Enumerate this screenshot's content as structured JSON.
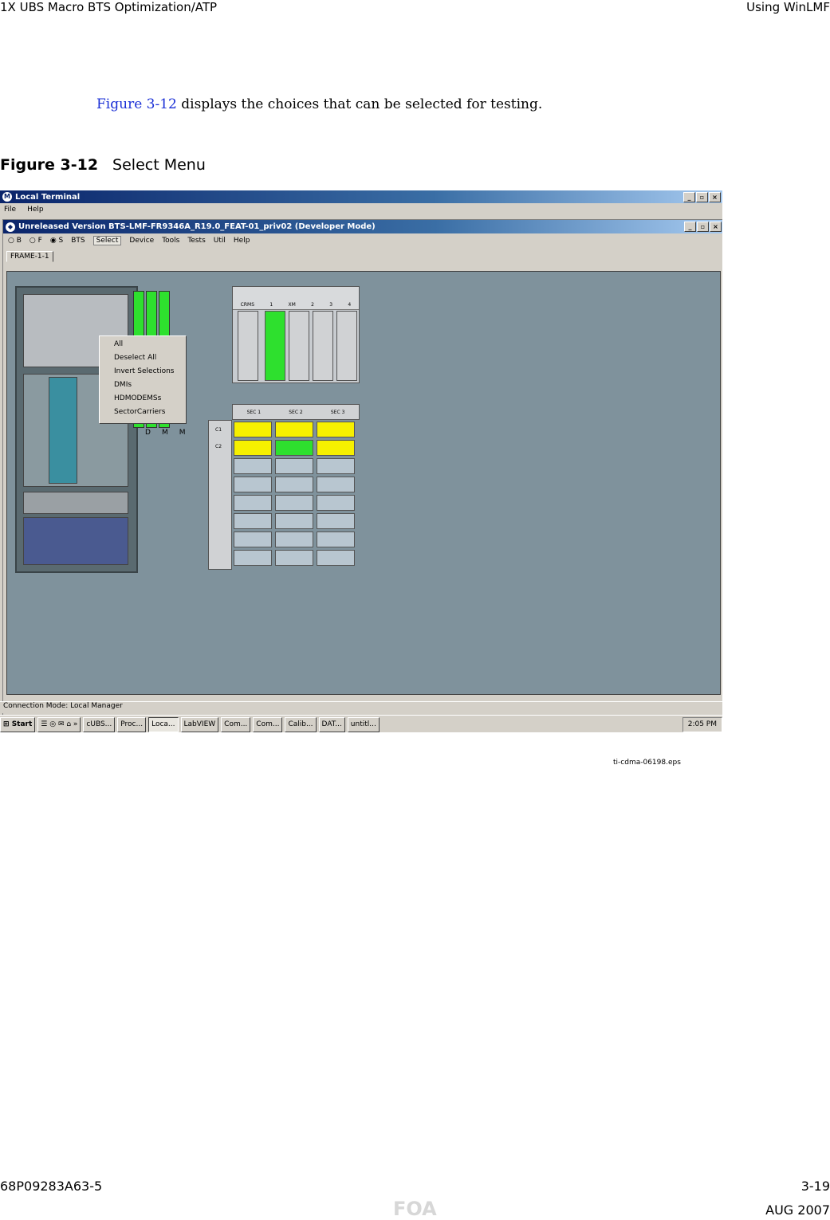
{
  "header": {
    "left": "1X UBS Macro BTS Optimization/ATP",
    "right": "Using WinLMF"
  },
  "intro": {
    "link": "Figure 3-12",
    "rest": " displays the choices that can be selected for testing."
  },
  "figure": {
    "number": "Figure 3-12",
    "title": "Select Menu"
  },
  "screenshot": {
    "outer_title": "Local Terminal",
    "outer_menu": [
      "File",
      "Help"
    ],
    "inner_title": "Unreleased Version BTS-LMF-FR9346A_R19.0_FEAT-01_priv02 (Developer Mode)",
    "radio_b": "B",
    "radio_f": "F",
    "radio_s": "S",
    "toolbar": [
      "BTS",
      "Select",
      "Device",
      "Tools",
      "Tests",
      "Util",
      "Help"
    ],
    "tab": "FRAME-1-1",
    "dropdown": [
      "All",
      "Deselect All",
      "Invert Selections",
      "DMIs",
      "HDMODEMSs",
      "SectorCarriers"
    ],
    "card_labels": [
      "D",
      "M",
      "M"
    ],
    "xcvr_header": {
      "left": "CRMS",
      "right": "XM",
      "nums": [
        "1",
        "2",
        "3",
        "4"
      ]
    },
    "sectors": [
      "SEC 1",
      "SEC 2",
      "SEC 3"
    ],
    "carriers": [
      "C1",
      "C2"
    ],
    "status": "Connection Mode: Local Manager",
    "taskbar": {
      "start": "Start",
      "tasks": [
        "cUBS...",
        "Proc...",
        "Loca...",
        "LabVIEW",
        "Com...",
        "Com...",
        "Calib...",
        "DAT...",
        "untitl..."
      ],
      "time": "2:05 PM"
    },
    "colors": {
      "active_card": "#2ee02e",
      "carrier_yellow": "#f6f000"
    }
  },
  "caption_file": "ti-cdma-06198.eps",
  "footer": {
    "left": "68P09283A63-5",
    "right": "3-19",
    "center": "FOA",
    "date": "AUG 2007"
  }
}
